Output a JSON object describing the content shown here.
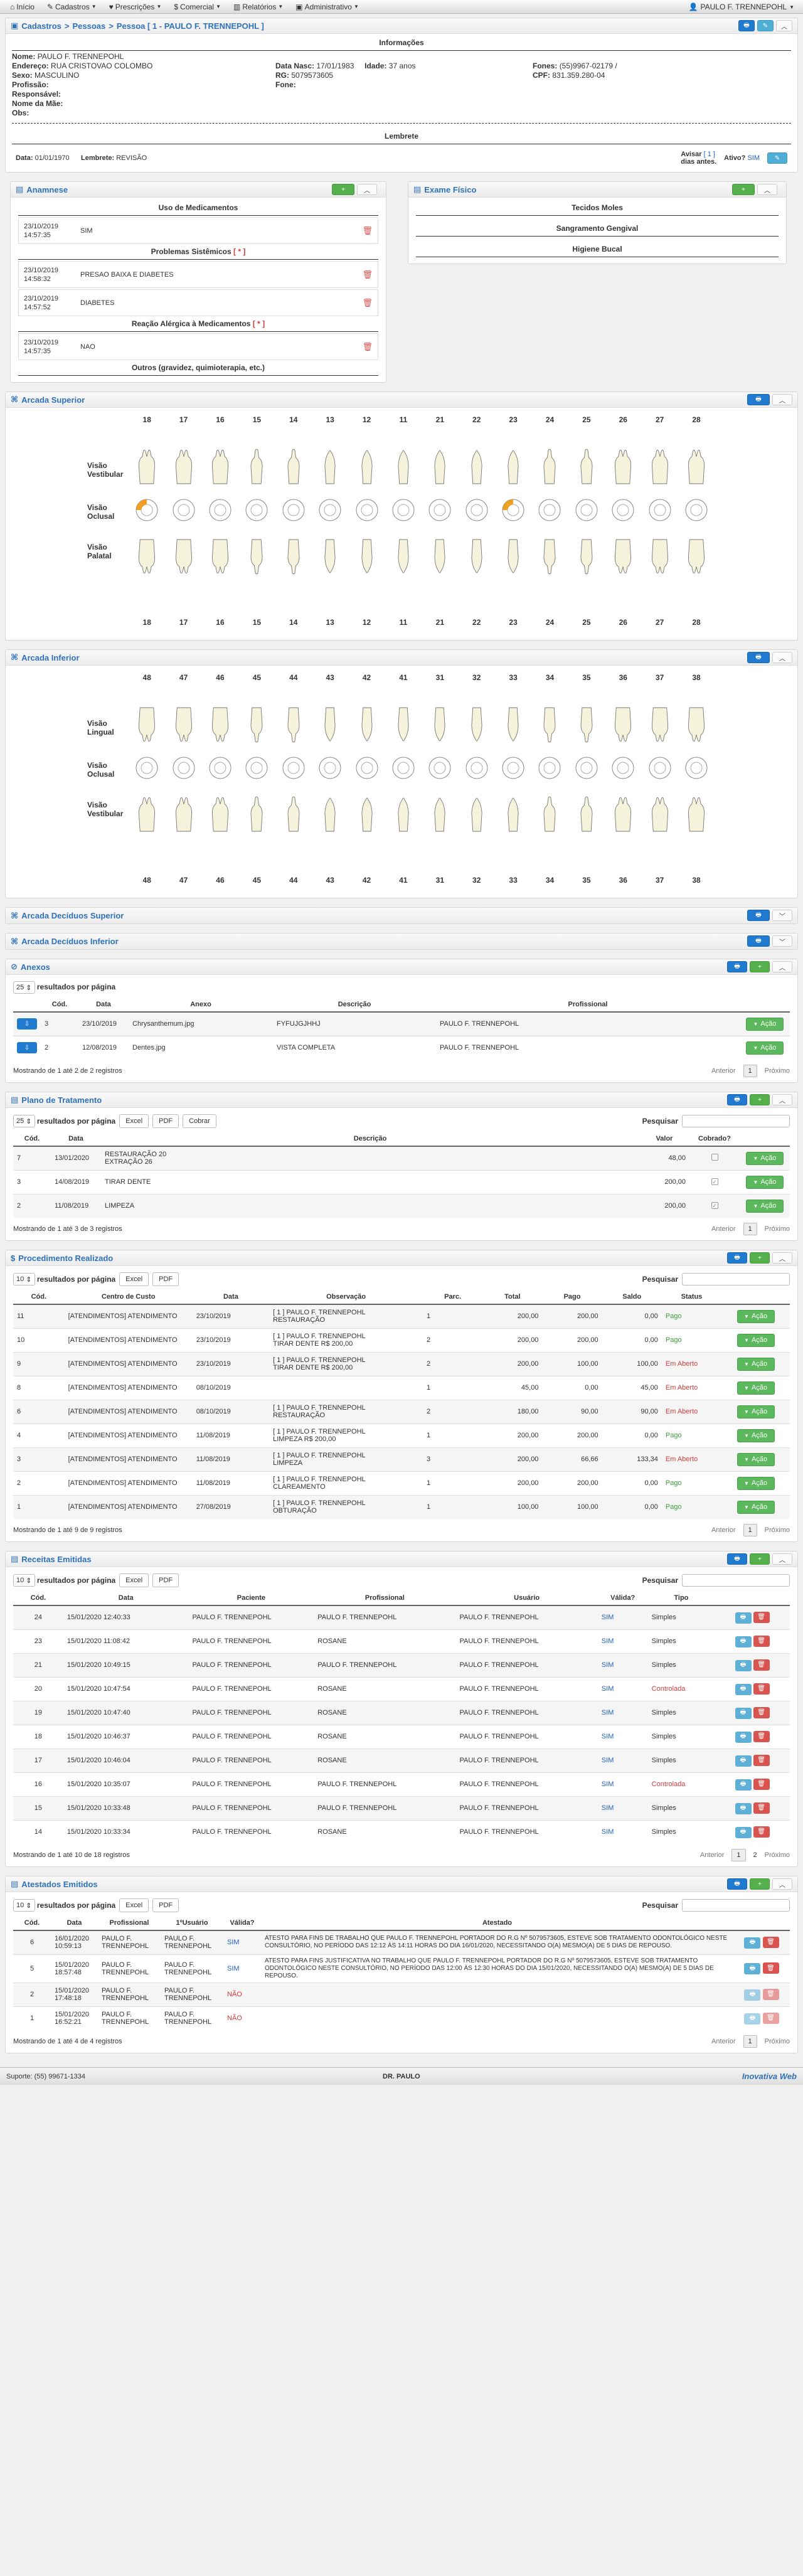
{
  "nav": {
    "items": [
      {
        "label": "Início",
        "icon": "home-icon"
      },
      {
        "label": "Cadastros",
        "icon": "wrench-icon"
      },
      {
        "label": "Prescrições",
        "icon": "clipboard-icon"
      },
      {
        "label": "Comercial",
        "icon": "dollar-icon"
      },
      {
        "label": "Relatórios",
        "icon": "chart-icon"
      },
      {
        "label": "Administrativo",
        "icon": "briefcase-icon"
      }
    ],
    "user": "PAULO F. TRENNEPOHL"
  },
  "breadcrumb": {
    "parts": [
      "Cadastros",
      "Pessoas",
      "Pessoa [ 1 -  PAULO F. TRENNEPOHL ]"
    ]
  },
  "info": {
    "heading": "Informações",
    "nome_label": "Nome:",
    "nome": "PAULO F. TRENNEPOHL",
    "endereco_label": "Endereço:",
    "endereco": "RUA CRISTOVAO COLOMBO",
    "sexo_label": "Sexo:",
    "sexo": "MASCULINO",
    "profissao_label": "Profissão:",
    "responsavel_label": "Responsável:",
    "mae_label": "Nome da Mãe:",
    "obs_label": "Obs:",
    "nasc_label": "Data Nasc:",
    "nasc": "17/01/1983",
    "idade_label": "Idade:",
    "idade": "37 anos",
    "rg_label": "RG:",
    "rg": "5079573605",
    "fone_label": "Fone:",
    "fones_label": "Fones:",
    "fones": "(55)9967-02179 /",
    "cpf_label": "CPF:",
    "cpf": "831.359.280-04"
  },
  "lembrete": {
    "heading": "Lembrete",
    "data_label": "Data:",
    "data": "01/01/1970",
    "lembrete_label": "Lembrete:",
    "lembrete": "REVISÃO",
    "avisar_label": "Avisar",
    "avisar_value": "[ 1 ]",
    "avisar_suffix": "dias antes.",
    "ativo_label": "Ativo?",
    "ativo": "SIM"
  },
  "anamnese": {
    "title": "Anamnese",
    "sections": [
      {
        "heading": "Uso de Medicamentos",
        "required": "",
        "items": [
          {
            "date": "23/10/2019",
            "time": "14:57:35",
            "value": "SIM"
          }
        ]
      },
      {
        "heading": "Problemas Sistêmicos",
        "required": "[ * ]",
        "items": [
          {
            "date": "23/10/2019",
            "time": "14:58:32",
            "value": "PRESAO BAIXA E DIABETES"
          },
          {
            "date": "23/10/2019",
            "time": "14:57:52",
            "value": "DIABETES"
          }
        ]
      },
      {
        "heading": "Reação Alérgica à Medicamentos",
        "required": "[ * ]",
        "items": [
          {
            "date": "23/10/2019",
            "time": "14:57:35",
            "value": "NAO"
          }
        ]
      },
      {
        "heading": "Outros (gravidez, quimioterapia, etc.)",
        "required": "",
        "items": []
      }
    ]
  },
  "exame": {
    "title": "Exame Físico",
    "sections": [
      "Tecidos Moles",
      "Sangramento Gengival",
      "Higiene Bucal"
    ]
  },
  "arcada_superior": {
    "title": "Arcada Superior",
    "numbers": [
      "18",
      "17",
      "16",
      "15",
      "14",
      "13",
      "12",
      "11",
      "21",
      "22",
      "23",
      "24",
      "25",
      "26",
      "27",
      "28"
    ],
    "labels": [
      "Visão Vestibular",
      "Visão Oclusal",
      "Visão Palatal"
    ],
    "marked": [
      0,
      10
    ]
  },
  "arcada_inferior": {
    "title": "Arcada Inferior",
    "numbers": [
      "48",
      "47",
      "46",
      "45",
      "44",
      "43",
      "42",
      "41",
      "31",
      "32",
      "33",
      "34",
      "35",
      "36",
      "37",
      "38"
    ],
    "labels": [
      "Visão Lingual",
      "Visão Oclusal",
      "Visão Vestibular"
    ]
  },
  "deciduos_sup": {
    "title": "Arcada Decíduos Superior"
  },
  "deciduos_inf": {
    "title": "Arcada Decíduos Inferior"
  },
  "anexos": {
    "title": "Anexos",
    "per_page": "25",
    "per_page_label": "resultados por página",
    "columns": [
      "Cód.",
      "Data",
      "Anexo",
      "Descrição",
      "Profissional"
    ],
    "rows": [
      [
        "3",
        "23/10/2019",
        "Chrysanthemum.jpg",
        "FYFUJGJHHJ",
        "PAULO F. TRENNEPOHL"
      ],
      [
        "2",
        "12/08/2019",
        "Dentes.jpg",
        "VISTA COMPLETA",
        "PAULO F. TRENNEPOHL"
      ]
    ],
    "action": "Ação",
    "footer": "Mostrando de 1 até 2 de 2 registros",
    "prev": "Anterior",
    "page": "1",
    "next": "Próximo"
  },
  "plano": {
    "title": "Plano de Tratamento",
    "per_page": "25",
    "per_page_label": "resultados por página",
    "btns": [
      "Excel",
      "PDF",
      "Cobrar"
    ],
    "search_label": "Pesquisar",
    "columns": [
      "Cód.",
      "Data",
      "Descrição",
      "Valor",
      "Cobrado?"
    ],
    "rows": [
      [
        "7",
        "13/01/2020",
        "RESTAURAÇÃO 20\nEXTRAÇÃO 26",
        "48,00",
        ""
      ],
      [
        "3",
        "14/08/2019",
        "TIRAR DENTE",
        "200,00",
        "x"
      ],
      [
        "2",
        "11/08/2019",
        "LIMPEZA",
        "200,00",
        "x"
      ]
    ],
    "action": "Ação",
    "footer": "Mostrando de 1 até 3 de 3 registros",
    "prev": "Anterior",
    "page": "1",
    "next": "Próximo"
  },
  "procedimento": {
    "title": "Procedimento Realizado",
    "per_page": "10",
    "per_page_label": "resultados por página",
    "btns": [
      "Excel",
      "PDF"
    ],
    "search_label": "Pesquisar",
    "columns": [
      "Cód.",
      "Centro de Custo",
      "Data",
      "Observação",
      "Parc.",
      "Total",
      "Pago",
      "Saldo",
      "Status"
    ],
    "rows": [
      [
        "11",
        "[ATENDIMENTOS] ATENDIMENTO",
        "23/10/2019",
        "[ 1 ] PAULO F. TRENNEPOHL\nRESTAURAÇÃO",
        "1",
        "200,00",
        "200,00",
        "0,00",
        "Pago"
      ],
      [
        "10",
        "[ATENDIMENTOS] ATENDIMENTO",
        "23/10/2019",
        "[ 1 ] PAULO F. TRENNEPOHL\nTIRAR DENTE R$ 200,00",
        "2",
        "200,00",
        "200,00",
        "0,00",
        "Pago"
      ],
      [
        "9",
        "[ATENDIMENTOS] ATENDIMENTO",
        "23/10/2019",
        "[ 1 ] PAULO F. TRENNEPOHL\nTIRAR DENTE R$ 200,00",
        "2",
        "200,00",
        "100,00",
        "100,00",
        "Em Aberto"
      ],
      [
        "8",
        "[ATENDIMENTOS] ATENDIMENTO",
        "08/10/2019",
        "",
        "1",
        "45,00",
        "0,00",
        "45,00",
        "Em Aberto"
      ],
      [
        "6",
        "[ATENDIMENTOS] ATENDIMENTO",
        "08/10/2019",
        "[ 1 ] PAULO F. TRENNEPOHL\nRESTAURAÇÃO",
        "2",
        "180,00",
        "90,00",
        "90,00",
        "Em Aberto"
      ],
      [
        "4",
        "[ATENDIMENTOS] ATENDIMENTO",
        "11/08/2019",
        "[ 1 ] PAULO F. TRENNEPOHL\nLIMPEZA R$ 200,00",
        "1",
        "200,00",
        "200,00",
        "0,00",
        "Pago"
      ],
      [
        "3",
        "[ATENDIMENTOS] ATENDIMENTO",
        "11/08/2019",
        "[ 1 ] PAULO F. TRENNEPOHL\nLIMPEZA",
        "3",
        "200,00",
        "66,66",
        "133,34",
        "Em Aberto"
      ],
      [
        "2",
        "[ATENDIMENTOS] ATENDIMENTO",
        "11/08/2019",
        "[ 1 ] PAULO F. TRENNEPOHL\nCLAREAMENTO",
        "1",
        "200,00",
        "200,00",
        "0,00",
        "Pago"
      ],
      [
        "1",
        "[ATENDIMENTOS] ATENDIMENTO",
        "27/08/2019",
        "[ 1 ] PAULO F. TRENNEPOHL\nOBTURAÇÃO",
        "1",
        "100,00",
        "100,00",
        "0,00",
        "Pago"
      ]
    ],
    "action": "Ação",
    "footer": "Mostrando de 1 até 9 de 9 registros",
    "prev": "Anterior",
    "page": "1",
    "next": "Próximo"
  },
  "receitas": {
    "title": "Receitas Emitidas",
    "per_page": "10",
    "per_page_label": "resultados por página",
    "btns": [
      "Excel",
      "PDF"
    ],
    "search_label": "Pesquisar",
    "columns": [
      "Cód.",
      "Data",
      "Paciente",
      "Profissional",
      "Usuário",
      "Válida?",
      "Tipo"
    ],
    "rows": [
      [
        "24",
        "15/01/2020 12:40:33",
        "PAULO F. TRENNEPOHL",
        "PAULO F. TRENNEPOHL",
        "PAULO F. TRENNEPOHL",
        "SIM",
        "Simples"
      ],
      [
        "23",
        "15/01/2020 11:08:42",
        "PAULO F. TRENNEPOHL",
        "ROSANE",
        "PAULO F. TRENNEPOHL",
        "SIM",
        "Simples"
      ],
      [
        "21",
        "15/01/2020 10:49:15",
        "PAULO F. TRENNEPOHL",
        "PAULO F. TRENNEPOHL",
        "PAULO F. TRENNEPOHL",
        "SIM",
        "Simples"
      ],
      [
        "20",
        "15/01/2020 10:47:54",
        "PAULO F. TRENNEPOHL",
        "ROSANE",
        "PAULO F. TRENNEPOHL",
        "SIM",
        "Controlada"
      ],
      [
        "19",
        "15/01/2020 10:47:40",
        "PAULO F. TRENNEPOHL",
        "ROSANE",
        "PAULO F. TRENNEPOHL",
        "SIM",
        "Simples"
      ],
      [
        "18",
        "15/01/2020 10:46:37",
        "PAULO F. TRENNEPOHL",
        "ROSANE",
        "PAULO F. TRENNEPOHL",
        "SIM",
        "Simples"
      ],
      [
        "17",
        "15/01/2020 10:46:04",
        "PAULO F. TRENNEPOHL",
        "ROSANE",
        "PAULO F. TRENNEPOHL",
        "SIM",
        "Simples"
      ],
      [
        "16",
        "15/01/2020 10:35:07",
        "PAULO F. TRENNEPOHL",
        "PAULO F. TRENNEPOHL",
        "PAULO F. TRENNEPOHL",
        "SIM",
        "Controlada"
      ],
      [
        "15",
        "15/01/2020 10:33:48",
        "PAULO F. TRENNEPOHL",
        "PAULO F. TRENNEPOHL",
        "PAULO F. TRENNEPOHL",
        "SIM",
        "Simples"
      ],
      [
        "14",
        "15/01/2020 10:33:34",
        "PAULO F. TRENNEPOHL",
        "ROSANE",
        "PAULO F. TRENNEPOHL",
        "SIM",
        "Simples"
      ]
    ],
    "footer": "Mostrando de 1 até 10 de 18 registros",
    "prev": "Anterior",
    "page": "1",
    "page2": "2",
    "next": "Próximo"
  },
  "atestados": {
    "title": "Atestados Emitidos",
    "per_page": "10",
    "per_page_label": "resultados por página",
    "btns": [
      "Excel",
      "PDF"
    ],
    "search_label": "Pesquisar",
    "columns": [
      "Cód.",
      "Data",
      "Profissional",
      "1ºUsuário",
      "Válida?",
      "Atestado"
    ],
    "rows": [
      [
        "6",
        "16/01/2020 10:59:13",
        "PAULO F. TRENNEPOHL",
        "PAULO F. TRENNEPOHL",
        "SIM",
        "ATESTO PARA FINS DE TRABALHO QUE PAULO F. TRENNEPOHL PORTADOR DO R.G Nº 5079573605, ESTEVE SOB TRATAMENTO ODONTOLÓGICO NESTE CONSULTÓRIO, NO PERÍODO DAS 12:12 ÀS 14:11 HORAS DO DIA 16/01/2020, NECESSITANDO O(A) MESMO(A) DE 5 DIAS DE REPOUSO."
      ],
      [
        "5",
        "15/01/2020 18:57:48",
        "PAULO F. TRENNEPOHL",
        "PAULO F. TRENNEPOHL",
        "SIM",
        "ATESTO PARA FINS JUSTIFICATIVA NO TRABALHO QUE PAULO F. TRENNEPOHL PORTADOR DO R.G Nº 5079573605, ESTEVE SOB TRATAMENTO ODONTOLÓGICO NESTE CONSULTÓRIO, NO PERÍODO DAS 12:00 ÀS 12:30 HORAS DO DIA 15/01/2020, NECESSITANDO O(A) MESMO(A) DE 5 DIAS DE REPOUSO."
      ],
      [
        "2",
        "15/01/2020 17:48:18",
        "PAULO F. TRENNEPOHL",
        "PAULO F. TRENNEPOHL",
        "NÃO",
        ""
      ],
      [
        "1",
        "15/01/2020 16:52:21",
        "PAULO F. TRENNEPOHL",
        "PAULO F. TRENNEPOHL",
        "NÃO",
        ""
      ]
    ],
    "footer": "Mostrando de 1 até 4 de 4 registros",
    "prev": "Anterior",
    "page": "1",
    "next": "Próximo"
  },
  "footer": {
    "support": "Suporte: (55) 99671-1334",
    "doctor": "DR. PAULO",
    "brand": "Inovativa Web"
  },
  "colors": {
    "accent": "#2f72b8",
    "success": "#5cb85c",
    "danger": "#d9534f",
    "info": "#1f7ad0"
  }
}
